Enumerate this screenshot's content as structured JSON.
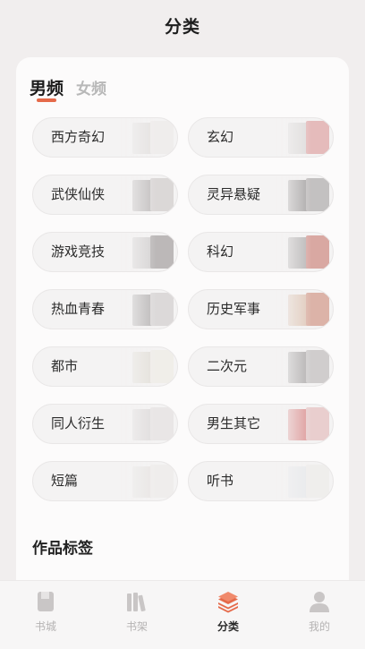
{
  "header": {
    "title": "分类"
  },
  "tabs": [
    {
      "label": "男频",
      "active": true
    },
    {
      "label": "女频",
      "active": false
    }
  ],
  "categories": [
    {
      "label": "西方奇幻",
      "cover_colors": [
        "#d9d4d2",
        "#ece7e6"
      ]
    },
    {
      "label": "玄幻",
      "cover_colors": [
        "#cfcac9",
        "#d98c8c"
      ]
    },
    {
      "label": "武侠仙侠",
      "cover_colors": [
        "#9a9494",
        "#c7c1c0"
      ]
    },
    {
      "label": "灵异悬疑",
      "cover_colors": [
        "#6f6a6a",
        "#9c9797"
      ]
    },
    {
      "label": "游戏竞技",
      "cover_colors": [
        "#bdb8b8",
        "#8e8888"
      ]
    },
    {
      "label": "科幻",
      "cover_colors": [
        "#8a8585",
        "#c46a60"
      ]
    },
    {
      "label": "热血青春",
      "cover_colors": [
        "#8c8787",
        "#c9c4c4"
      ]
    },
    {
      "label": "历史军事",
      "cover_colors": [
        "#d2a98e",
        "#c97f6a"
      ]
    },
    {
      "label": "都市",
      "cover_colors": [
        "#d8d2c6",
        "#ede9e1"
      ]
    },
    {
      "label": "二次元",
      "cover_colors": [
        "#7f7a7a",
        "#b3aeae"
      ]
    },
    {
      "label": "同人衍生",
      "cover_colors": [
        "#cfc9c9",
        "#e0dada"
      ]
    },
    {
      "label": "男生其它",
      "cover_colors": [
        "#cc5050",
        "#e0b0b0"
      ]
    },
    {
      "label": "短篇",
      "cover_colors": [
        "#e0dbd8",
        "#ece8e6"
      ]
    },
    {
      "label": "听书",
      "cover_colors": [
        "#dfe1e6",
        "#ece9e6"
      ]
    }
  ],
  "section": {
    "title": "作品标签"
  },
  "bottom_nav": [
    {
      "label": "书城",
      "icon": "book-icon",
      "active": false
    },
    {
      "label": "书架",
      "icon": "bookshelf-icon",
      "active": false
    },
    {
      "label": "分类",
      "icon": "category-layers-icon",
      "active": true
    },
    {
      "label": "我的",
      "icon": "profile-icon",
      "active": false
    }
  ],
  "colors": {
    "accent": "#e56a4a",
    "background": "#f1eeee",
    "inactive_nav": "#c9c6c6"
  }
}
